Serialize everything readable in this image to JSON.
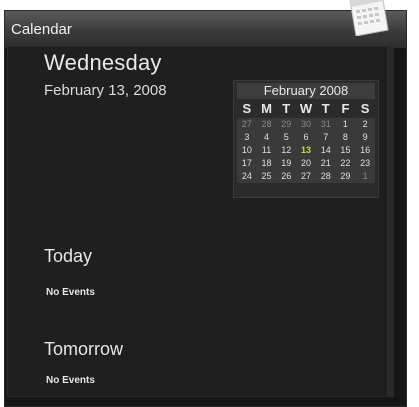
{
  "window": {
    "title": "Calendar"
  },
  "date": {
    "weekday": "Wednesday",
    "full": "February 13, 2008"
  },
  "mini_calendar": {
    "month_label": "February 2008",
    "days_of_week": [
      "S",
      "M",
      "T",
      "W",
      "T",
      "F",
      "S"
    ],
    "weeks": [
      [
        {
          "d": "27",
          "other": true
        },
        {
          "d": "28",
          "other": true
        },
        {
          "d": "29",
          "other": true
        },
        {
          "d": "30",
          "other": true
        },
        {
          "d": "31",
          "other": true
        },
        {
          "d": "1"
        },
        {
          "d": "2"
        }
      ],
      [
        {
          "d": "3"
        },
        {
          "d": "4"
        },
        {
          "d": "5"
        },
        {
          "d": "6"
        },
        {
          "d": "7"
        },
        {
          "d": "8"
        },
        {
          "d": "9"
        }
      ],
      [
        {
          "d": "10"
        },
        {
          "d": "11"
        },
        {
          "d": "12"
        },
        {
          "d": "13",
          "today": true
        },
        {
          "d": "14"
        },
        {
          "d": "15"
        },
        {
          "d": "16"
        }
      ],
      [
        {
          "d": "17"
        },
        {
          "d": "18"
        },
        {
          "d": "19"
        },
        {
          "d": "20"
        },
        {
          "d": "21"
        },
        {
          "d": "22"
        },
        {
          "d": "23"
        }
      ],
      [
        {
          "d": "24"
        },
        {
          "d": "25"
        },
        {
          "d": "26"
        },
        {
          "d": "27"
        },
        {
          "d": "28"
        },
        {
          "d": "29"
        },
        {
          "d": "1",
          "other": true
        }
      ]
    ]
  },
  "sections": {
    "today": {
      "heading": "Today",
      "events": "No Events"
    },
    "tomorrow": {
      "heading": "Tomorrow",
      "events": "No Events"
    }
  },
  "colors": {
    "today_highlight": "#cddc39",
    "background": "#1f1f1f"
  },
  "icons": {
    "gadget_icon": "calendar-pad-icon"
  }
}
